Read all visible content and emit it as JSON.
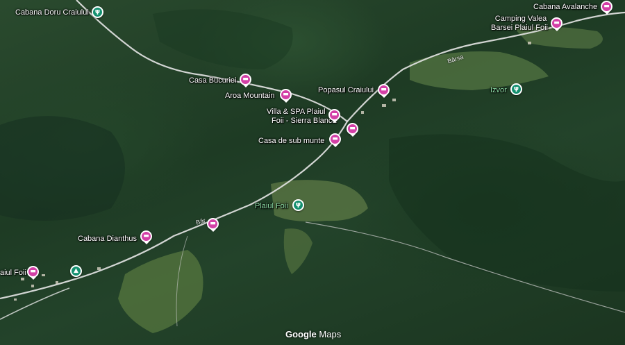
{
  "map": {
    "places": [
      {
        "name": "Cabana Doru Craiului",
        "type": "restaurant",
        "icon": "fork-knife-icon"
      },
      {
        "name": "Cabana Avalanche",
        "type": "lodging",
        "icon": "bed-icon"
      },
      {
        "name": "Camping Valea Barsei Plaiul Foii",
        "type": "lodging",
        "icon": "bed-icon"
      },
      {
        "name": "Casa Bucuriei",
        "type": "lodging",
        "icon": "bed-icon"
      },
      {
        "name": "Aroa Mountain",
        "type": "lodging",
        "icon": "bed-icon"
      },
      {
        "name": "Popasul Craiului",
        "type": "lodging",
        "icon": "bed-icon"
      },
      {
        "name": "Villa & SPA Plaiul Foii - Sierra Blanca",
        "type": "lodging",
        "icon": "bed-icon"
      },
      {
        "name": "",
        "type": "lodging",
        "icon": "bed-icon"
      },
      {
        "name": "Casa de sub munte",
        "type": "lodging",
        "icon": "bed-icon"
      },
      {
        "name": "Izvor",
        "type": "restaurant",
        "icon": "fork-knife-icon"
      },
      {
        "name": "Plaiul Foii",
        "type": "restaurant",
        "icon": "fork-knife-icon"
      },
      {
        "name": "",
        "type": "lodging",
        "icon": "bed-icon"
      },
      {
        "name": "Cabana Dianthus",
        "type": "lodging",
        "icon": "bed-icon"
      },
      {
        "name": "aiul Foii",
        "type": "lodging",
        "icon": "bed-icon"
      },
      {
        "name": "",
        "type": "campground",
        "icon": "tent-icon"
      }
    ],
    "labels": {
      "cabana_doru": "Cabana Doru Craiului",
      "cabana_avalanche": "Cabana Avalanche",
      "camping_line1": "Camping Valea",
      "camping_line2": "Barsei Plaiul Foii",
      "casa_bucuriei": "Casa Bucuriei",
      "aroa": "Aroa Mountain",
      "popasul": "Popasul Craiului",
      "villa_line1": "Villa & SPA Plaiul",
      "villa_line2": "Foii - Sierra Blanca",
      "casa_sub_munte": "Casa de sub munte",
      "izvor": "Izvor",
      "plaiul_foii": "Plaiul Foii",
      "cabana_dianthus": "Cabana Dianthus",
      "aiul_foii": "aiul Foii"
    },
    "roads": {
      "barsa_east": "Bârsa",
      "barsa_west": "Bâr"
    },
    "colors": {
      "lodging": "#d33fa6",
      "restaurant": "#14906f",
      "label_green": "#8fe0a8"
    }
  },
  "attribution": {
    "brand": "Google",
    "product": "Maps"
  }
}
